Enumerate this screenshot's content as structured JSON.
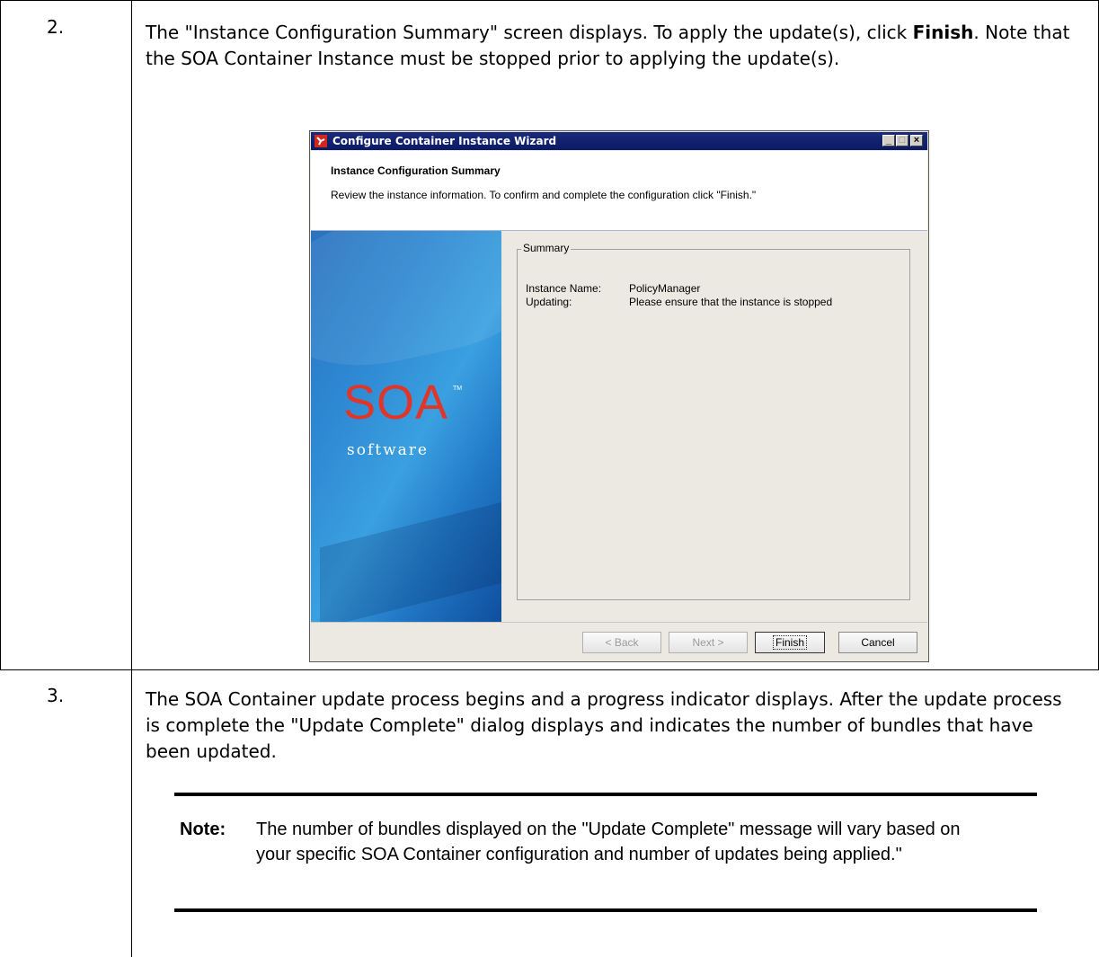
{
  "steps": [
    {
      "number": "2.",
      "text_before": "The \"Instance Configuration Summary\" screen displays. To apply the update(s), click ",
      "bold": "Finish",
      "text_after": ". Note that the SOA Container Instance must be stopped prior to applying the update(s)."
    },
    {
      "number": "3.",
      "text": "The SOA Container update process begins and a progress indicator displays. After the update process is complete the \"Update Complete\" dialog displays and indicates the number of bundles that have been updated."
    }
  ],
  "dialog": {
    "title": "Configure Container Instance Wizard",
    "header_title": "Instance Configuration Summary",
    "header_desc": "Review the instance information. To confirm and complete the configuration click \"Finish.\"",
    "logo_text": "SOA",
    "logo_tm": "TM",
    "logo_sub": "software",
    "group_label": "Summary",
    "rows": [
      {
        "label": "Instance Name:",
        "value": "PolicyManager"
      },
      {
        "label": "Updating:",
        "value": "Please ensure that the instance is stopped"
      }
    ],
    "buttons": {
      "back": "< Back",
      "next": "Next >",
      "finish": "Finish",
      "cancel": "Cancel"
    },
    "window_buttons": {
      "minimize": "_",
      "maximize": "□",
      "close": "×"
    }
  },
  "note": {
    "label": "Note:",
    "text": "The number of bundles displayed on the \"Update Complete\" message will vary based on your specific SOA Container configuration and number of updates being applied.\""
  }
}
